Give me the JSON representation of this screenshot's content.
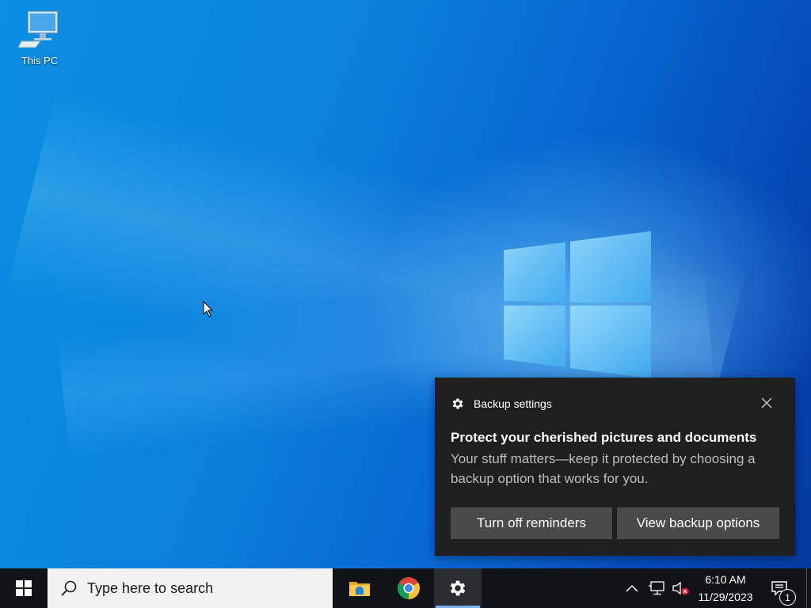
{
  "desktop": {
    "icons": [
      {
        "label": "This PC",
        "icon": "computer-icon"
      }
    ]
  },
  "toast": {
    "app_name": "Backup settings",
    "app_icon": "gear-icon",
    "title": "Protect your cherished pictures and documents",
    "body": "Your stuff matters—keep it protected by choosing a backup option that works for you.",
    "buttons": {
      "left": "Turn off reminders",
      "right": "View backup options"
    }
  },
  "taskbar": {
    "search_placeholder": "Type here to search",
    "pinned": [
      {
        "name": "File Explorer",
        "icon": "folder-icon"
      },
      {
        "name": "Google Chrome",
        "icon": "chrome-icon"
      },
      {
        "name": "Settings",
        "icon": "gear-icon",
        "active": true
      }
    ],
    "tray": {
      "clock_time": "6:10 AM",
      "clock_date": "11/29/2023",
      "notification_count": "1"
    }
  },
  "colors": {
    "taskbar": "#101418",
    "toast_bg": "#1f1f1f",
    "toast_button": "#4a4a4a",
    "active_indicator": "#7ab6ee"
  }
}
